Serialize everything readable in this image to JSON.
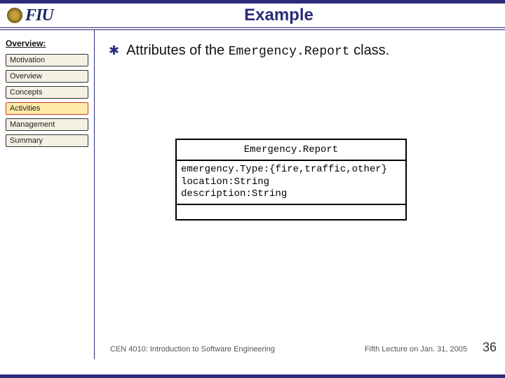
{
  "header": {
    "logo_text": "FIU",
    "title": "Example"
  },
  "sidebar": {
    "heading": "Overview:",
    "items": [
      {
        "label": "Motivation",
        "active": false
      },
      {
        "label": "Overview",
        "active": false
      },
      {
        "label": "Concepts",
        "active": false
      },
      {
        "label": "Activities",
        "active": true
      },
      {
        "label": "Management",
        "active": false
      },
      {
        "label": "Summary",
        "active": false
      }
    ]
  },
  "content": {
    "bullet_prefix": "Attributes of the ",
    "bullet_code": "Emergency.Report",
    "bullet_suffix": " class."
  },
  "uml": {
    "class_name": "Emergency.Report",
    "attributes": "emergency.Type:{fire,traffic,other}\nlocation:String\ndescription:String"
  },
  "footer": {
    "course": "CEN 4010: Introduction to Software Engineering",
    "date": "Fifth Lecture on Jan. 31, 2005",
    "page": "36"
  }
}
